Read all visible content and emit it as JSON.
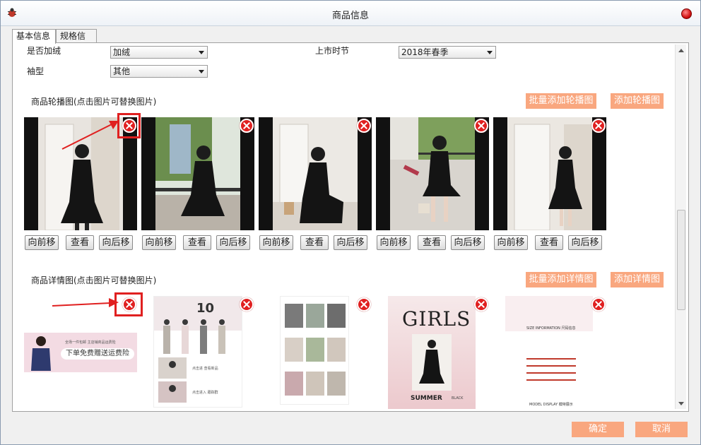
{
  "window": {
    "title": "商品信息"
  },
  "tabs": [
    {
      "label": "基本信息",
      "active": true
    },
    {
      "label": "规格信息",
      "active": false
    }
  ],
  "fields": {
    "plush": {
      "label": "是否加绒",
      "value": "加绒"
    },
    "sleeve": {
      "label": "袖型",
      "value": "其他"
    },
    "season": {
      "label": "上市时节",
      "value": "2018年春季"
    }
  },
  "carousel": {
    "title": "商品轮播图(点击图片可替换图片)",
    "batch_add": "批量添加轮播图",
    "add": "添加轮播图",
    "btn_prev": "向前移",
    "btn_view": "查看",
    "btn_next": "向后移"
  },
  "detail": {
    "title": "商品详情图(点击图片可替换图片)",
    "batch_add": "批量添加详情图",
    "add": "添加详情图",
    "img1_text": "下单免费赠送运费险",
    "img1_small": "全场一件包邮 主店铺商品运费险",
    "img2_num": "10",
    "img2_text1": "点击进 查看新品",
    "img2_text2": "点击进入 跟踪群",
    "img4_big": "GIRLS",
    "img4_small": "SUMMER",
    "img4_side": "BLACK",
    "img5_size": "SIZE INFORMATION 尺码信息",
    "img5_model": "MODEL DISPLAY 模特展示"
  },
  "footer": {
    "ok": "确定",
    "cancel": "取消"
  },
  "colors": {
    "accent": "#f9a77f",
    "delete": "#e02020"
  }
}
